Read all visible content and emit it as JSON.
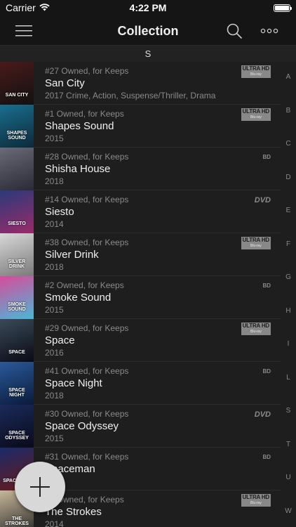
{
  "status": {
    "carrier": "Carrier",
    "time": "4:22 PM"
  },
  "nav": {
    "title": "Collection"
  },
  "section": {
    "letter": "S"
  },
  "index": [
    "A",
    "B",
    "C",
    "D",
    "E",
    "F",
    "G",
    "H",
    "I",
    "L",
    "S",
    "T",
    "U",
    "W"
  ],
  "items": [
    {
      "meta": "#27 Owned, for Keeps",
      "title": "San City",
      "sub": "2017 Crime, Action, Suspense/Thriller, Drama",
      "format": "uhd",
      "thumb_text": "SAN CITY",
      "thumb_colors": [
        "#4a1a1a",
        "#111111"
      ]
    },
    {
      "meta": "#1 Owned, for Keeps",
      "title": "Shapes Sound",
      "sub": "2015",
      "format": "uhd",
      "thumb_text": "SHAPES SOUND",
      "thumb_colors": [
        "#1a6e8e",
        "#0c2a3a"
      ]
    },
    {
      "meta": "#28 Owned, for Keeps",
      "title": "Shisha House",
      "sub": "2018",
      "format": "bluray",
      "thumb_text": "",
      "thumb_colors": [
        "#6a6a78",
        "#2a2a36"
      ]
    },
    {
      "meta": "#14 Owned, for Keeps",
      "title": "Siesto",
      "sub": "2014",
      "format": "dvd",
      "thumb_text": "SIESTO",
      "thumb_colors": [
        "#2a3a7a",
        "#9a2a6a"
      ]
    },
    {
      "meta": "#38 Owned, for Keeps",
      "title": "Silver Drink",
      "sub": "2018",
      "format": "uhd",
      "thumb_text": "SILVER DRINK",
      "thumb_colors": [
        "#d8d8d8",
        "#7a7a7a"
      ]
    },
    {
      "meta": "#2 Owned, for Keeps",
      "title": "Smoke Sound",
      "sub": "2015",
      "format": "bluray",
      "thumb_text": "SMOKE SOUND",
      "thumb_colors": [
        "#d94a9a",
        "#4ab8d8"
      ]
    },
    {
      "meta": "#29 Owned, for Keeps",
      "title": "Space",
      "sub": "2016",
      "format": "uhd",
      "thumb_text": "SPACE",
      "thumb_colors": [
        "#3a4a5a",
        "#0a0a14"
      ]
    },
    {
      "meta": "#41 Owned, for Keeps",
      "title": "Space Night",
      "sub": "2018",
      "format": "bluray",
      "thumb_text": "SPACE NIGHT",
      "thumb_colors": [
        "#2a5a9a",
        "#0a1a3a"
      ]
    },
    {
      "meta": "#30 Owned, for Keeps",
      "title": "Space Odyssey",
      "sub": "2015",
      "format": "dvd",
      "thumb_text": "SPACE ODYSSEY",
      "thumb_colors": [
        "#1a2a5a",
        "#0a0a1a"
      ]
    },
    {
      "meta": "#31 Owned, for Keeps",
      "title": "Spaceman",
      "sub": "",
      "format": "bluray",
      "thumb_text": "SPACEMAN",
      "thumb_colors": [
        "#1a2a6a",
        "#6a1a1a"
      ]
    },
    {
      "meta": "#4 Owned, for Keeps",
      "title": "The Strokes",
      "sub": "2014",
      "format": "uhd",
      "thumb_text": "THE STROKES",
      "thumb_colors": [
        "#c8b89a",
        "#2a2a2a"
      ]
    }
  ],
  "format_labels": {
    "uhd_top": "ULTRA HD",
    "uhd_bottom": "Blu-ray",
    "dvd": "DVD",
    "bluray": "BD"
  },
  "fab": {
    "label": "+"
  }
}
